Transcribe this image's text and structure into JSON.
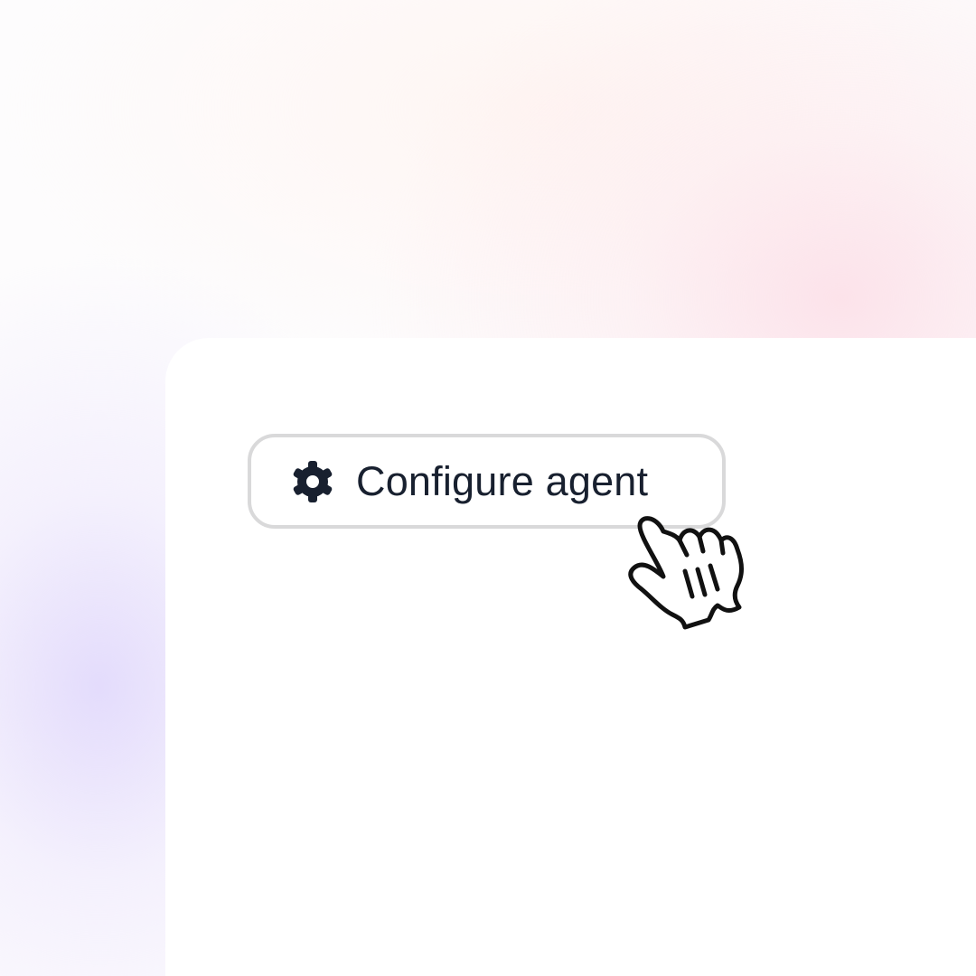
{
  "button": {
    "label": "Configure agent",
    "icon": "gear-icon"
  },
  "cursor": {
    "icon": "hand-pointer-icon"
  },
  "colors": {
    "button_text": "#18202f",
    "button_border": "#d9d9da",
    "panel": "#ffffff",
    "glow_pink": "#fcdae4",
    "glow_violet": "#e2dafc"
  }
}
